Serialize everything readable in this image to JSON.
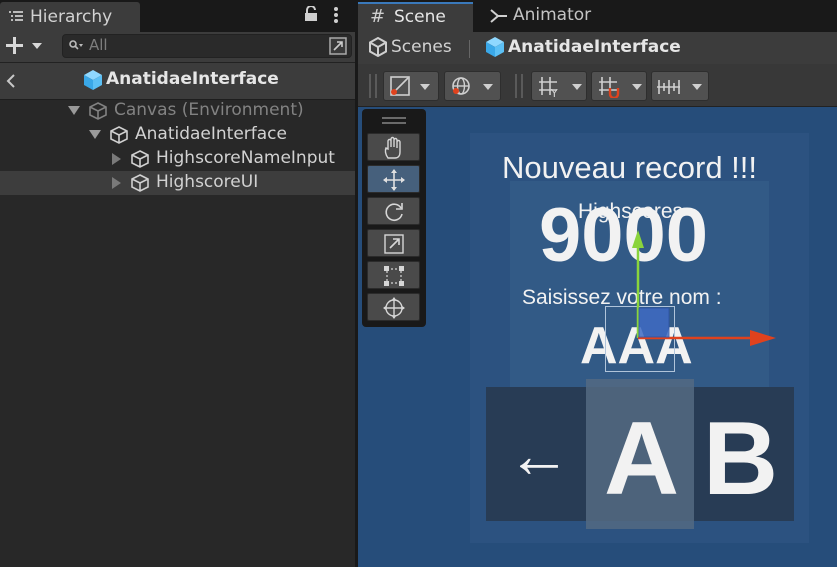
{
  "hierarchy": {
    "tab_label": "Hierarchy",
    "search_placeholder": "All",
    "header_title": "AnatidaeInterface",
    "items": [
      {
        "label": "Canvas (Environment)"
      },
      {
        "label": "AnatidaeInterface"
      },
      {
        "label": "HighscoreNameInput"
      },
      {
        "label": "HighscoreUI"
      }
    ]
  },
  "scene": {
    "tabs": [
      {
        "label": "Scene"
      },
      {
        "label": "Animator"
      }
    ],
    "breadcrumb": {
      "root": "Scenes",
      "current": "AnatidaeInterface"
    },
    "game_ui": {
      "title": "Nouveau record !!!",
      "highscores_label": "Highscores",
      "score": "9000",
      "prompt": "Saisissez votre nom :",
      "name": "AAA",
      "arrow": "←",
      "key_a": "A",
      "key_b": "B"
    }
  },
  "colors": {
    "accent": "#3a79bb",
    "viewport_bg": "#264d7a",
    "gizmo_x": "#e0421d",
    "gizmo_y": "#8ad43c",
    "gizmo_plane": "#3f6bc4"
  },
  "icons": {
    "hierarchy": "list-icon",
    "lock": "lock-icon",
    "menu": "kebab-menu-icon",
    "add": "plus-icon",
    "search": "search-icon",
    "scene_tab": "grid-icon",
    "animator_tab": "animator-icon",
    "back": "chevron-left-icon",
    "prefab": "prefab-cube-icon"
  }
}
